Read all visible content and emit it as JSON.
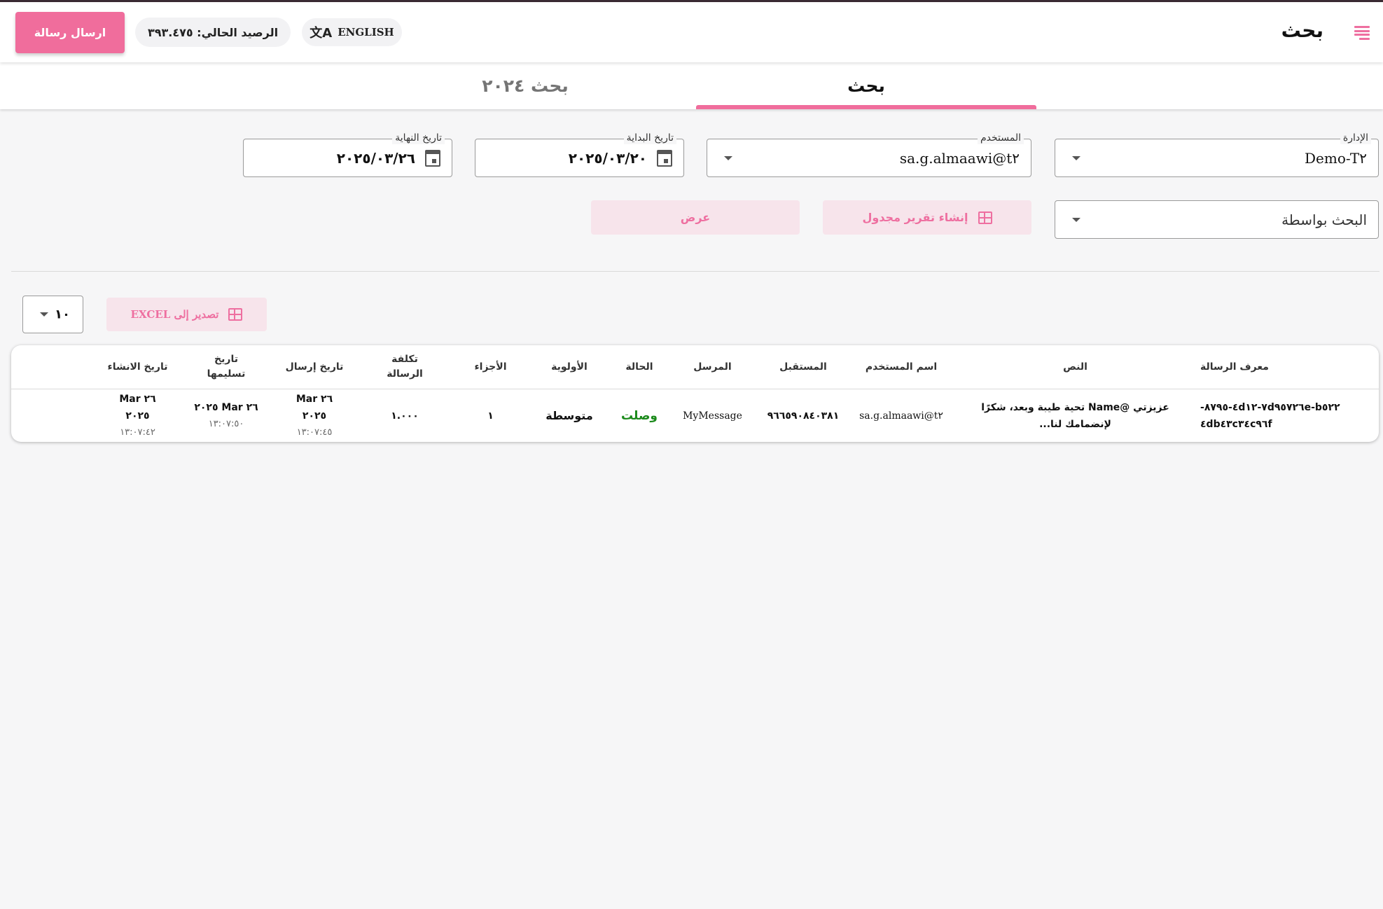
{
  "header": {
    "title": "بحث",
    "send_button": "ارسال رسالة",
    "balance": "الرصيد الحالي: ٣٩٣.٤٧٥",
    "language": "ENGLISH"
  },
  "tabs": [
    {
      "label": "بحث",
      "active": true
    },
    {
      "label": "بحث ٢٠٢٤",
      "active": false
    }
  ],
  "filters": {
    "department": {
      "label": "الإدارة",
      "value": "Demo-T٢"
    },
    "user": {
      "label": "المستخدم",
      "value": "g.almaawi@t٢.sa"
    },
    "start_date": {
      "label": "تاريخ البداية",
      "value": "٢٠٢٥/٠٣/٢٠"
    },
    "end_date": {
      "label": "تاريخ النهاية",
      "value": "٢٠٢٥/٠٣/٢٦"
    },
    "search_by": {
      "value": "البحث بواسطة"
    }
  },
  "actions": {
    "schedule_report": "إنشاء تقرير مجدول",
    "view": "عرض",
    "export_excel": "تصدير إلى EXCEL",
    "page_size": "١٠"
  },
  "table": {
    "columns": [
      "معرف الرسالة",
      "النص",
      "اسم المستخدم",
      "المستقبل",
      "المرسل",
      "الحالة",
      "الأولوية",
      "الأجزاء",
      "تكلفة الرسالة",
      "تاريخ إرسال",
      "تاريخ تسليمها",
      "تاريخ الانشاء"
    ],
    "rows": [
      {
        "id_line1": "٧d٩٥٧٢٦e-b٥٢٢-٤d١٢-٨٧٩٥-",
        "id_line2": "٤db٤٣c٣٤c٩٦f",
        "text_line1": "عزيزتي @Name تحية طيبة وبعد، شكرًا",
        "text_line2": "لإنضمامك لنا...",
        "username": "g.almaawi@t٢.sa",
        "receiver": "٩٦٦٥٩٠٨٤٠٣٨١",
        "sender": "MyMessage",
        "status": "وصلت",
        "priority": "متوسطة",
        "parts": "١",
        "cost": "١.٠٠٠",
        "sent_date_line1": "٢٦ Mar",
        "sent_date_line2": "٢٠٢٥",
        "sent_time": "١٣:٠٧:٤٥",
        "delivered_date": "٢٦ Mar ٢٠٢٥",
        "delivered_time": "١٣:٠٧:٥٠",
        "created_date_line1": "٢٦ Mar",
        "created_date_line2": "٢٠٢٥",
        "created_time": "١٣:٠٧:٤٢"
      }
    ]
  },
  "colors": {
    "accent": "#f06d9c",
    "accent_pale": "#f7e4eb",
    "status_success": "#1b8a1b"
  }
}
